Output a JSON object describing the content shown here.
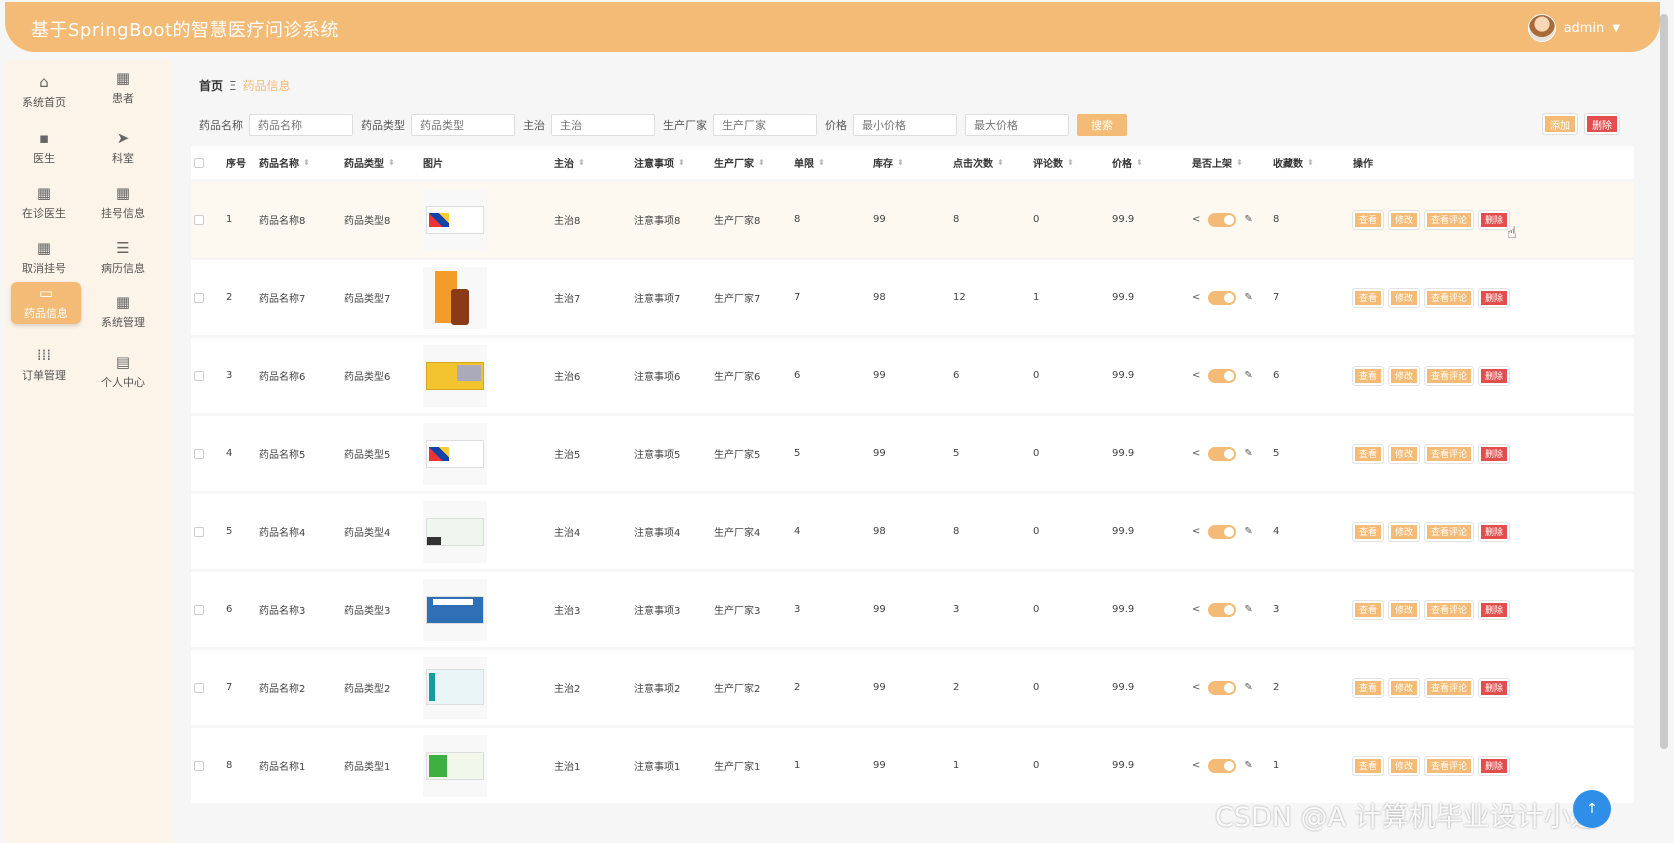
{
  "app": {
    "title": "基于SpringBoot的智慧医疗问诊系统",
    "user": "admin",
    "accent": "#f4bb76",
    "danger": "#e44d4d"
  },
  "sidebar": {
    "items": [
      {
        "label": "系统首页",
        "icon": "home-icon"
      },
      {
        "label": "患者",
        "icon": "grid-icon"
      },
      {
        "label": "医生",
        "icon": "chat-icon"
      },
      {
        "label": "科室",
        "icon": "send-icon"
      },
      {
        "label": "在诊医生",
        "icon": "grid-icon"
      },
      {
        "label": "挂号信息",
        "icon": "grid-icon"
      },
      {
        "label": "取消挂号",
        "icon": "grid-icon"
      },
      {
        "label": "病历信息",
        "icon": "list-icon"
      },
      {
        "label": "药品信息",
        "icon": "monitor-icon",
        "active": true
      },
      {
        "label": "系统管理",
        "icon": "grid-icon"
      },
      {
        "label": "订单管理",
        "icon": "apps-icon"
      },
      {
        "label": "个人中心",
        "icon": "card-icon"
      }
    ]
  },
  "breadcrumb": {
    "home": "首页",
    "sep": "Ξ",
    "current": "药品信息"
  },
  "filters": {
    "name_label": "药品名称",
    "name_placeholder": "药品名称",
    "type_label": "药品类型",
    "type_placeholder": "药品类型",
    "treat_label": "主治",
    "treat_placeholder": "主治",
    "maker_label": "生产厂家",
    "maker_placeholder": "生产厂家",
    "price_label": "价格",
    "min_placeholder": "最小价格",
    "max_placeholder": "最大价格",
    "search": "搜索"
  },
  "toolbar": {
    "add": "添加",
    "delete": "删除"
  },
  "table": {
    "headers": [
      "序号",
      "药品名称",
      "药品类型",
      "图片",
      "主治",
      "注意事项",
      "生产厂家",
      "单限",
      "库存",
      "点击次数",
      "评论数",
      "价格",
      "是否上架",
      "收藏数",
      "操作"
    ],
    "actions": {
      "view": "查看",
      "edit": "修改",
      "comments": "查看评论",
      "delete": "删除"
    },
    "rows": [
      {
        "idx": "1",
        "name": "药品名称8",
        "type": "药品类型8",
        "treat": "主治8",
        "note": "注意事项8",
        "maker": "生产厂家8",
        "limit": "8",
        "stock": "99",
        "clicks": "8",
        "comments": "0",
        "price": "99.9",
        "fav": "8"
      },
      {
        "idx": "2",
        "name": "药品名称7",
        "type": "药品类型7",
        "treat": "主治7",
        "note": "注意事项7",
        "maker": "生产厂家7",
        "limit": "7",
        "stock": "98",
        "clicks": "12",
        "comments": "1",
        "price": "99.9",
        "fav": "7"
      },
      {
        "idx": "3",
        "name": "药品名称6",
        "type": "药品类型6",
        "treat": "主治6",
        "note": "注意事项6",
        "maker": "生产厂家6",
        "limit": "6",
        "stock": "99",
        "clicks": "6",
        "comments": "0",
        "price": "99.9",
        "fav": "6"
      },
      {
        "idx": "4",
        "name": "药品名称5",
        "type": "药品类型5",
        "treat": "主治5",
        "note": "注意事项5",
        "maker": "生产厂家5",
        "limit": "5",
        "stock": "99",
        "clicks": "5",
        "comments": "0",
        "price": "99.9",
        "fav": "5"
      },
      {
        "idx": "5",
        "name": "药品名称4",
        "type": "药品类型4",
        "treat": "主治4",
        "note": "注意事项4",
        "maker": "生产厂家4",
        "limit": "4",
        "stock": "98",
        "clicks": "8",
        "comments": "0",
        "price": "99.9",
        "fav": "4"
      },
      {
        "idx": "6",
        "name": "药品名称3",
        "type": "药品类型3",
        "treat": "主治3",
        "note": "注意事项3",
        "maker": "生产厂家3",
        "limit": "3",
        "stock": "99",
        "clicks": "3",
        "comments": "0",
        "price": "99.9",
        "fav": "3"
      },
      {
        "idx": "7",
        "name": "药品名称2",
        "type": "药品类型2",
        "treat": "主治2",
        "note": "注意事项2",
        "maker": "生产厂家2",
        "limit": "2",
        "stock": "99",
        "clicks": "2",
        "comments": "0",
        "price": "99.9",
        "fav": "2"
      },
      {
        "idx": "8",
        "name": "药品名称1",
        "type": "药品类型1",
        "treat": "主治1",
        "note": "注意事项1",
        "maker": "生产厂家1",
        "limit": "1",
        "stock": "99",
        "clicks": "1",
        "comments": "0",
        "price": "99.9",
        "fav": "1"
      }
    ]
  },
  "watermark": "CSDN @A 计算机毕业设计小途"
}
